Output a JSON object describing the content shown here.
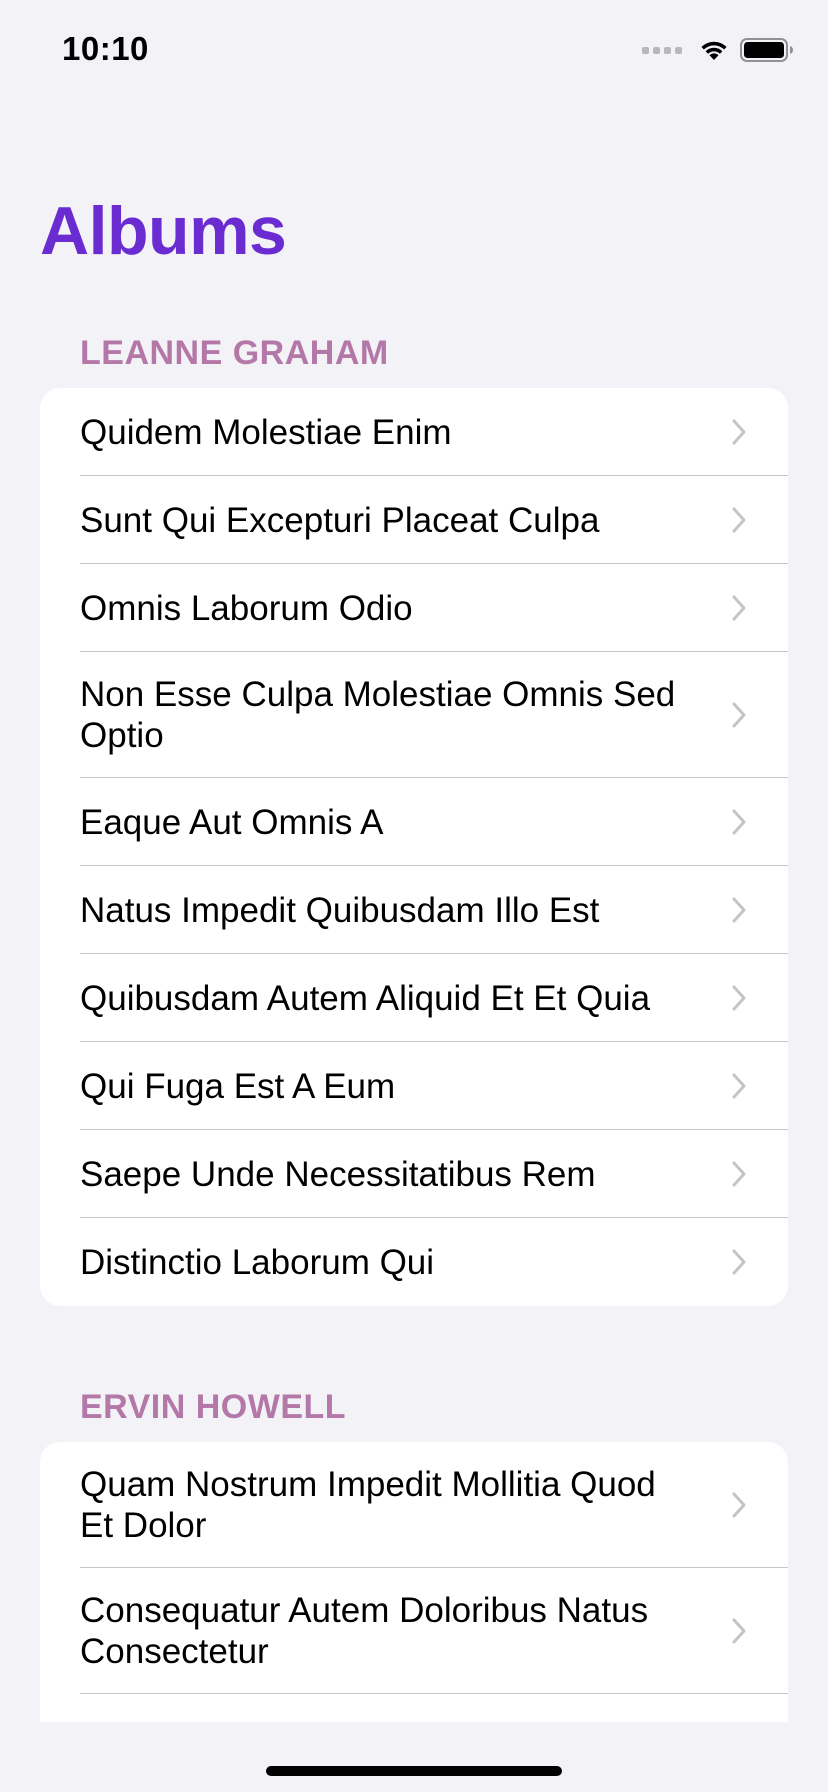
{
  "status": {
    "time": "10:10"
  },
  "page": {
    "title": "Albums"
  },
  "sections": [
    {
      "header": "LEANNE GRAHAM",
      "items": [
        {
          "label": "Quidem Molestiae Enim"
        },
        {
          "label": "Sunt Qui Excepturi Placeat Culpa"
        },
        {
          "label": "Omnis Laborum Odio"
        },
        {
          "label": "Non Esse Culpa Molestiae Omnis Sed Optio"
        },
        {
          "label": "Eaque Aut Omnis A"
        },
        {
          "label": "Natus Impedit Quibusdam Illo Est"
        },
        {
          "label": "Quibusdam Autem Aliquid Et Et Quia"
        },
        {
          "label": "Qui Fuga Est A Eum"
        },
        {
          "label": "Saepe Unde Necessitatibus Rem"
        },
        {
          "label": "Distinctio Laborum Qui"
        }
      ]
    },
    {
      "header": "ERVIN HOWELL",
      "items": [
        {
          "label": "Quam Nostrum Impedit Mollitia Quod Et Dolor"
        },
        {
          "label": "Consequatur Autem Doloribus Natus Consectetur"
        },
        {
          "label": ""
        }
      ]
    }
  ],
  "icons": {
    "chevron": "chevron-right-icon",
    "wifi": "wifi-icon",
    "battery": "battery-icon",
    "signal": "cellular-signal-icon"
  },
  "colors": {
    "title": "#6a2bd1",
    "section_header": "#b478a8",
    "background": "#f2f2f7",
    "card": "#ffffff",
    "chevron": "#c4c4c7",
    "divider": "#c6c6c8"
  }
}
